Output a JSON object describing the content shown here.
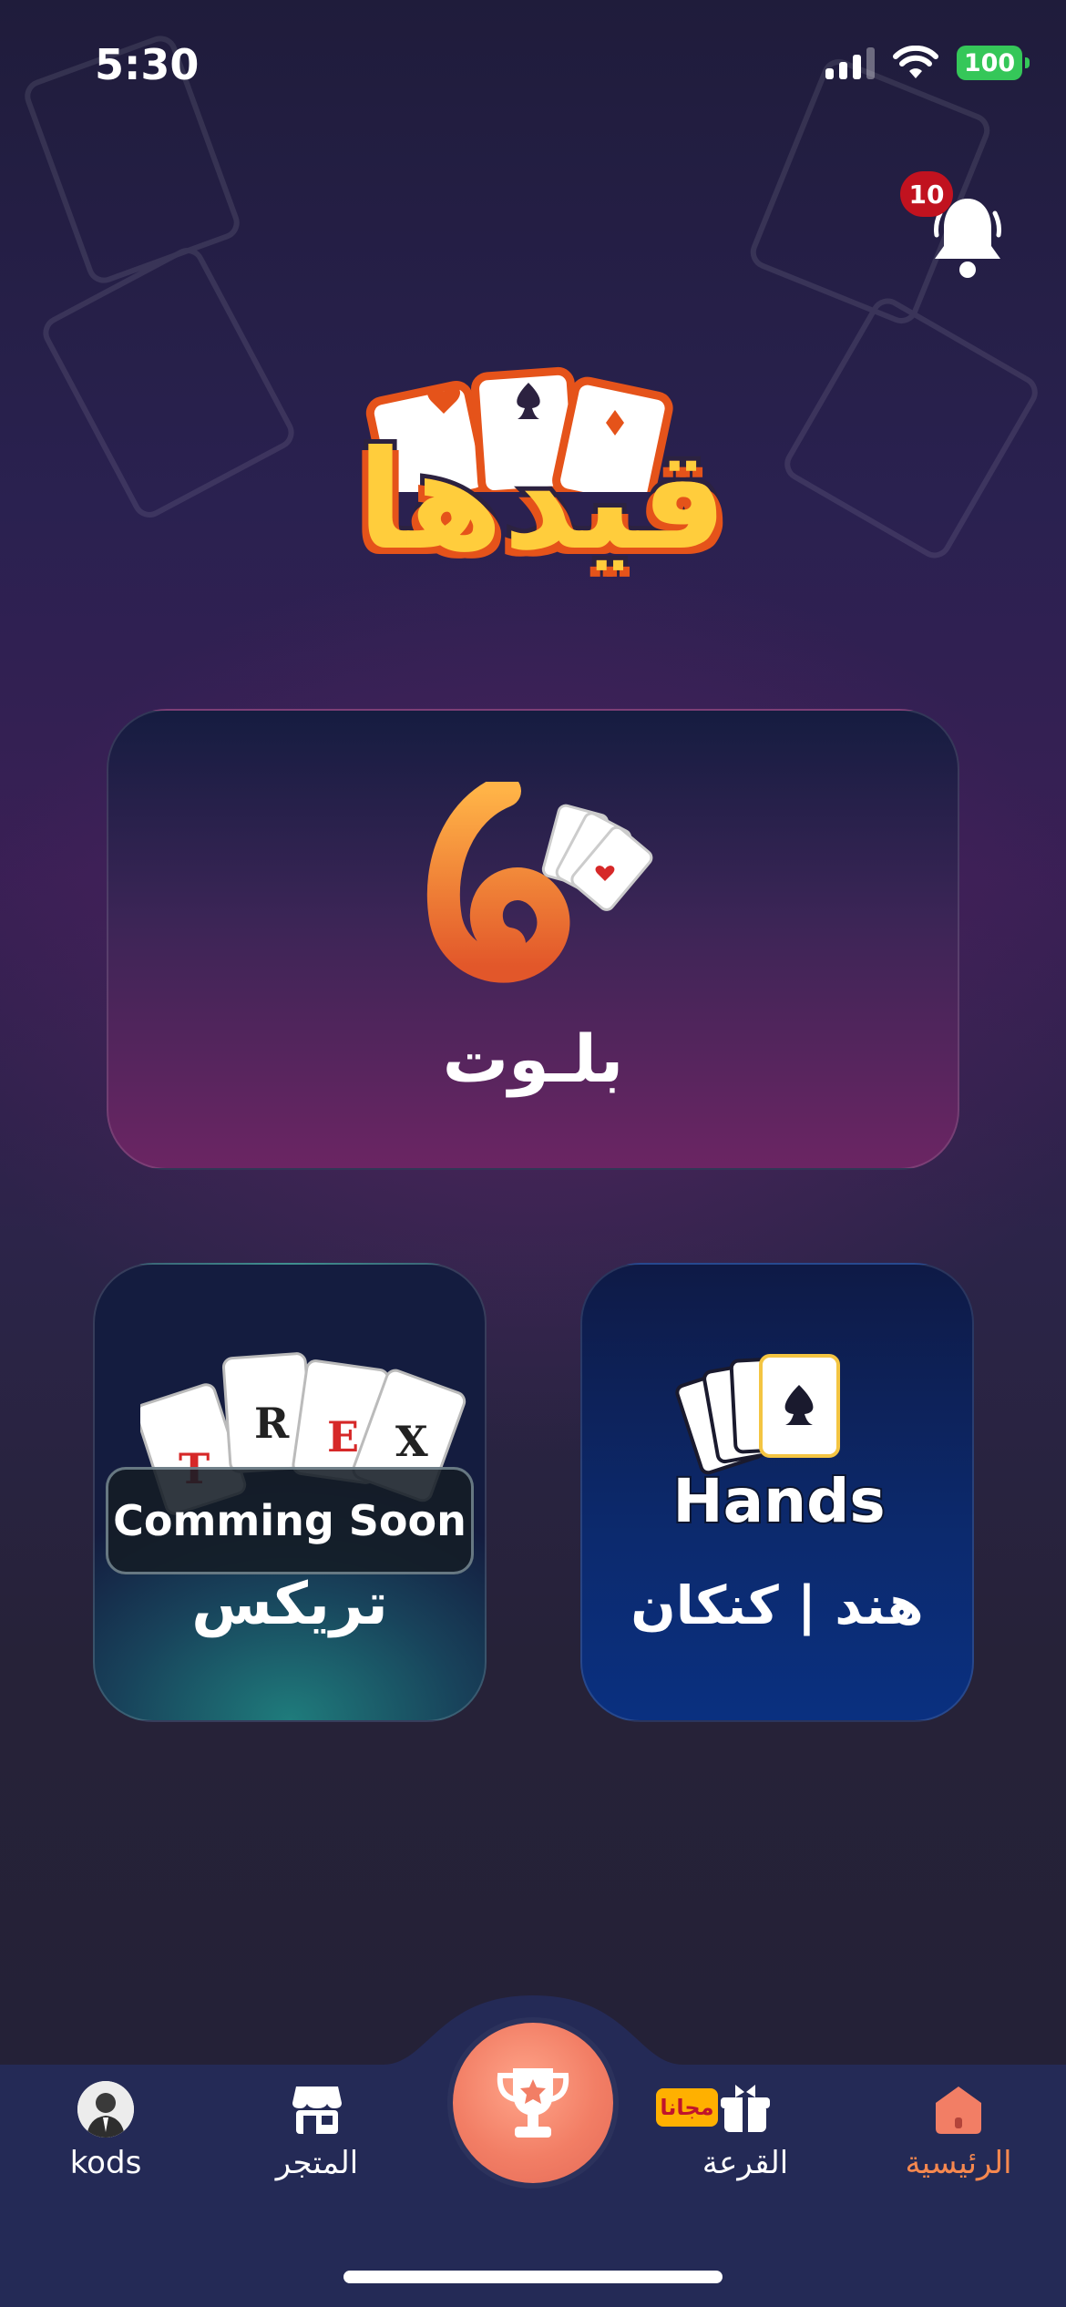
{
  "status_bar": {
    "time": "5:30",
    "battery": "100"
  },
  "notifications": {
    "count": "10"
  },
  "logo": {
    "text": "قيدها"
  },
  "games": {
    "baloot": {
      "title": "بلـوت"
    },
    "trex": {
      "title": "تريكس",
      "badge": "Comming Soon",
      "art_letters": [
        "T",
        "R",
        "E",
        "X"
      ]
    },
    "hands": {
      "title": "هند | كنكان",
      "art_text": "Hands"
    }
  },
  "nav": {
    "home": {
      "label": "الرئيسية"
    },
    "draw": {
      "label": "القرعة",
      "badge": "مجانا"
    },
    "tournaments": {
      "label": ""
    },
    "store": {
      "label": "المتجر"
    },
    "profile": {
      "label": "kods"
    }
  },
  "colors": {
    "accent": "#f6884f",
    "badge_red": "#c1121f",
    "free_badge": "#ffb000",
    "battery": "#35c759"
  }
}
